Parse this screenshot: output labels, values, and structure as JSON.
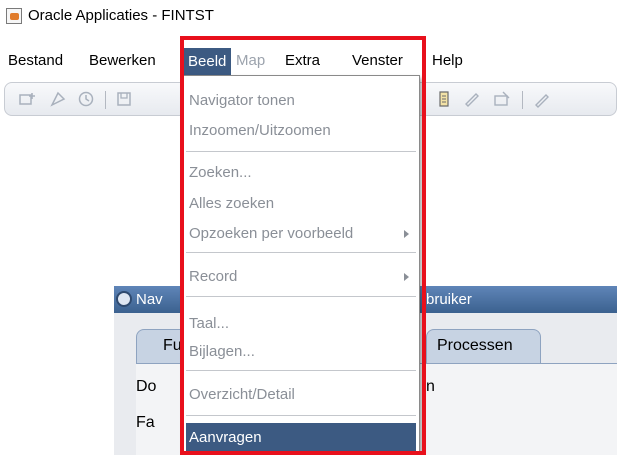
{
  "window": {
    "title": "Oracle Applicaties - FINTST",
    "icon": "java-cup-icon"
  },
  "menubar": [
    {
      "label": "Bestand",
      "state": "normal"
    },
    {
      "label": "Bewerken",
      "state": "normal"
    },
    {
      "label": "Beeld",
      "state": "active"
    },
    {
      "label": "Map",
      "state": "disabled"
    },
    {
      "label": "Extra",
      "state": "normal"
    },
    {
      "label": "Venster",
      "state": "normal"
    },
    {
      "label": "Help",
      "state": "normal"
    }
  ],
  "toolbar": {
    "icons": [
      "new-record-icon",
      "find-icon",
      "history-icon",
      "save-icon",
      "attachments-icon",
      "edit-icon",
      "clear-icon",
      "translate-icon"
    ]
  },
  "dropdown": {
    "items": [
      {
        "label": "Navigator tonen",
        "has_submenu": false,
        "selected": false
      },
      {
        "label": "Inzoomen/Uitzoomen",
        "has_submenu": false,
        "selected": false
      },
      {
        "label": "Zoeken...",
        "has_submenu": false,
        "selected": false
      },
      {
        "label": "Alles zoeken",
        "has_submenu": false,
        "selected": false
      },
      {
        "label": "Opzoeken per voorbeeld",
        "has_submenu": true,
        "selected": false
      },
      {
        "label": "Record",
        "has_submenu": true,
        "selected": false
      },
      {
        "label": "Taal...",
        "has_submenu": false,
        "selected": false
      },
      {
        "label": "Bijlagen...",
        "has_submenu": false,
        "selected": false
      },
      {
        "label": "Overzicht/Detail",
        "has_submenu": false,
        "selected": false
      },
      {
        "label": "Aanvragen",
        "has_submenu": false,
        "selected": true
      }
    ]
  },
  "background_window": {
    "title_left": "Nav",
    "title_right": "bruiker",
    "tabs": [
      "Fu",
      "Processen"
    ],
    "body_left": [
      "Do",
      "Fa"
    ],
    "body_right": "n"
  },
  "colors": {
    "menu_active": "#3c5a82",
    "highlight_border": "#e8101c",
    "disabled_text": "#8a8f97"
  }
}
